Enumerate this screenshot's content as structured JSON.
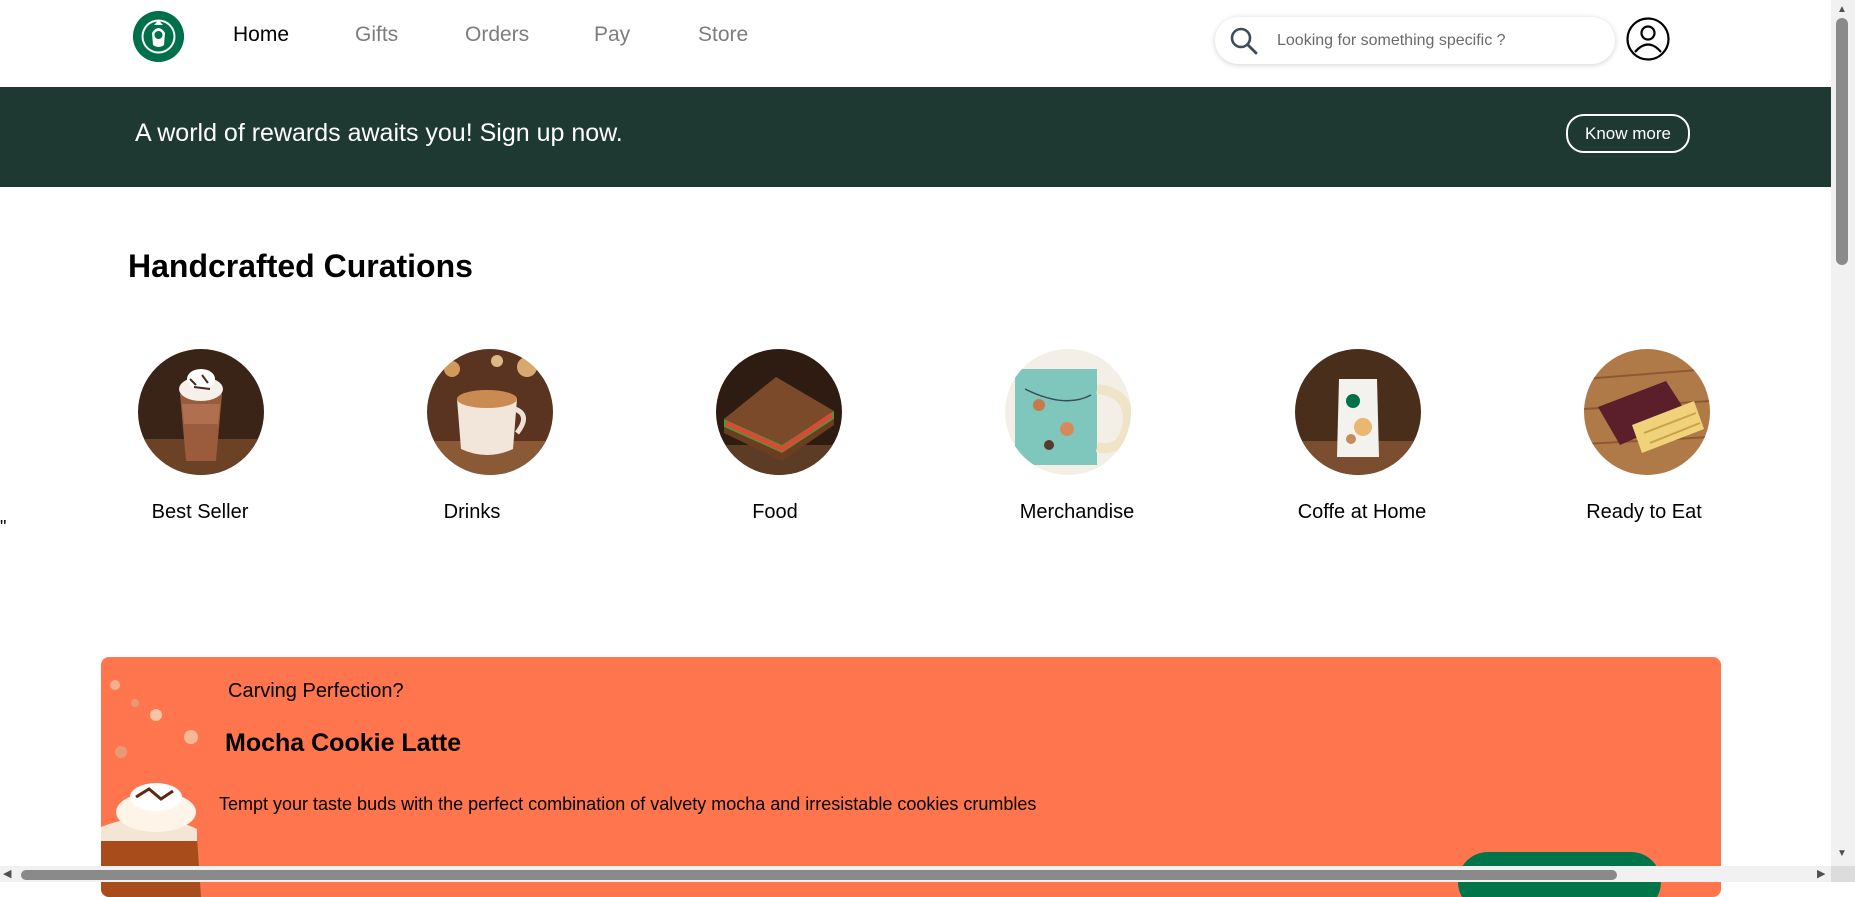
{
  "header": {
    "logo": "starbucks-siren-logo",
    "nav": [
      {
        "label": "Home",
        "active": true
      },
      {
        "label": "Gifts",
        "active": false
      },
      {
        "label": "Orders",
        "active": false
      },
      {
        "label": "Pay",
        "active": false
      },
      {
        "label": "Store",
        "active": false
      }
    ],
    "search": {
      "placeholder": "Looking for something specific ?",
      "value": "",
      "icon": "search-icon"
    },
    "account_icon": "user-icon"
  },
  "banner": {
    "text": "A world of rewards awaits you! Sign up now.",
    "button_label": "Know more"
  },
  "curations": {
    "title": "Handcrafted Curations",
    "categories": [
      {
        "label": "Best Seller",
        "icon": "frappuccino-image"
      },
      {
        "label": "Drinks",
        "icon": "latte-cup-image"
      },
      {
        "label": "Food",
        "icon": "sandwich-image"
      },
      {
        "label": "Merchandise",
        "icon": "mug-image"
      },
      {
        "label": "Coffe at Home",
        "icon": "coffee-bag-image"
      },
      {
        "label": "Ready to Eat",
        "icon": "chocolate-box-image"
      }
    ]
  },
  "stray_text": "\"",
  "promo": {
    "kicker": "Carving Perfection?",
    "title": "Mocha Cookie Latte",
    "description": "Tempt your taste buds with the perfect combination of valvety mocha and irresistable cookies crumbles",
    "image": "mocha-cookie-latte-image"
  },
  "colors": {
    "banner_bg": "#1e3932",
    "brand_green": "#00704a",
    "promo_bg": "#fe754e",
    "nav_inactive": "#7d7d7d"
  }
}
